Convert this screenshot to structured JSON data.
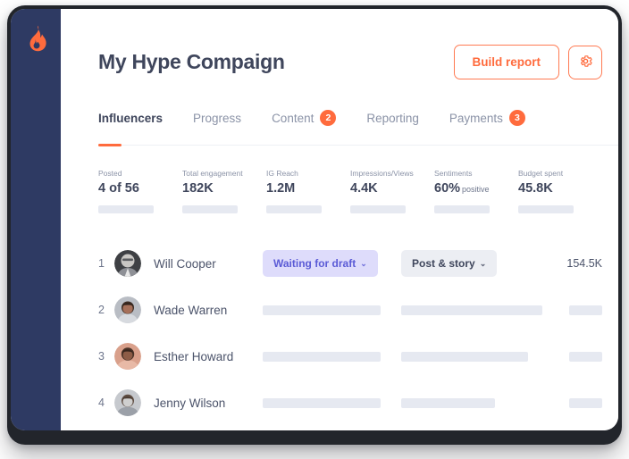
{
  "brand": {
    "logo_icon": "flame-icon",
    "sidebar_color": "#2e3a63",
    "accent_color": "#ff6b3d"
  },
  "header": {
    "title": "My Hype Compaign",
    "build_report_label": "Build report",
    "settings_icon": "gear-icon"
  },
  "tabs": [
    {
      "label": "Influencers",
      "badge": "",
      "active": true
    },
    {
      "label": "Progress",
      "badge": "",
      "active": false
    },
    {
      "label": "Content",
      "badge": "2",
      "active": false
    },
    {
      "label": "Reporting",
      "badge": "",
      "active": false
    },
    {
      "label": "Payments",
      "badge": "3",
      "active": false
    }
  ],
  "stats": [
    {
      "label": "Posted",
      "value": "4 of 56",
      "suffix": ""
    },
    {
      "label": "Total engagement",
      "value": "182K",
      "suffix": ""
    },
    {
      "label": "IG Reach",
      "value": "1.2M",
      "suffix": ""
    },
    {
      "label": "Impressions/Views",
      "value": "4.4K",
      "suffix": ""
    },
    {
      "label": "Sentiments",
      "value": "60%",
      "suffix": "positive"
    },
    {
      "label": "Budget spent",
      "value": "45.8K",
      "suffix": ""
    }
  ],
  "influencers": [
    {
      "index": "1",
      "name": "Will Cooper",
      "avatar": "avatar-will-cooper",
      "status": "Waiting for draft",
      "type": "Post & story",
      "reach": "154.5K",
      "redacted": false
    },
    {
      "index": "2",
      "name": "Wade Warren",
      "avatar": "avatar-wade-warren",
      "status": "",
      "type": "",
      "reach": "",
      "redacted": true,
      "bar_status_width": 132,
      "bar_type_width": 158,
      "bar_reach_width": 37
    },
    {
      "index": "3",
      "name": "Esther Howard",
      "avatar": "avatar-esther-howard",
      "status": "",
      "type": "",
      "reach": "",
      "redacted": true,
      "bar_status_width": 132,
      "bar_type_width": 142,
      "bar_reach_width": 37
    },
    {
      "index": "4",
      "name": "Jenny Wilson",
      "avatar": "avatar-jenny-wilson",
      "status": "",
      "type": "",
      "reach": "",
      "redacted": true,
      "bar_status_width": 132,
      "bar_type_width": 105,
      "bar_reach_width": 37
    }
  ],
  "icons": {
    "caret_down": "⌄"
  }
}
